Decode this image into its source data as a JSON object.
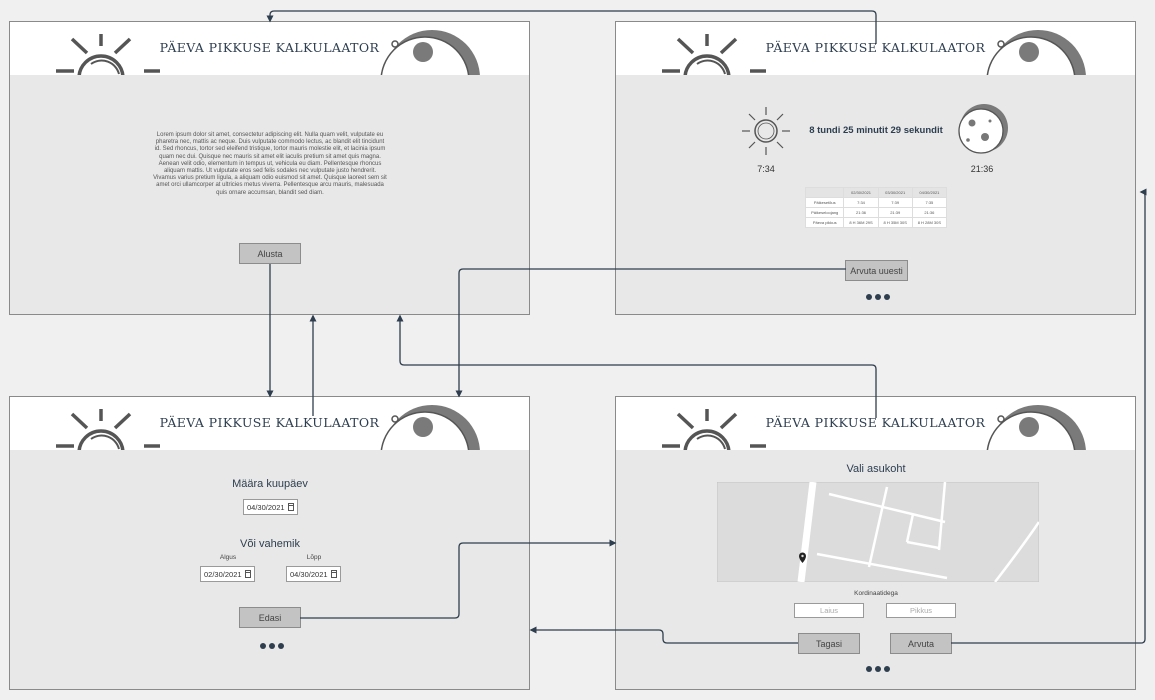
{
  "app": {
    "title": "PÄEVA PIKKUSE KALKULAATOR"
  },
  "colors": {
    "accent": "#2f3e4e",
    "panel": "#e8e8e8",
    "button": "#c3c3c3"
  },
  "screen_start": {
    "intro_text": "Lorem ipsum dolor sit amet, consectetur adipiscing elit. Nulla quam velit, vulputate eu pharetra nec, mattis ac neque. Duis vulputate commodo lectus, ac blandit elit tincidunt id. Sed rhoncus, tortor sed eleifend tristique, tortor mauris molestie elit, et lacinia ipsum quam nec dui. Quisque nec mauris sit amet elit iaculis pretium sit amet quis magna. Aenean velit odio, elementum in tempus ut, vehicula eu diam. Pellentesque rhoncus aliquam mattis. Ut vulputate eros sed felis sodales nec vulputate justo hendrerit. Vivamus varius pretium ligula, a aliquam odio euismod sit amet. Quisque laoreet sem sit amet orci ullamcorper at ultricies metus viverra. Pellentesque arcu mauris, malesuada quis ornare accumsan, blandit sed diam.",
    "start_button": "Alusta"
  },
  "screen_result": {
    "day_length": "8 tundi 25 minutit 29 sekundit",
    "sunrise": "7:34",
    "sunset": "21:36",
    "table": {
      "headers": [
        "",
        "02/30/2021",
        "03/30/2021",
        "04/30/2021"
      ],
      "rows": [
        [
          "Päikesetõus",
          "7:34",
          "7:39",
          "7:35"
        ],
        [
          "Päikeseloojang",
          "21:36",
          "21:39",
          "21:36"
        ],
        [
          "Päeva pikkus",
          "8 H 36M 29S",
          "8 H 35M 30S",
          "8 H 28M 30S"
        ]
      ]
    },
    "recalc_button": "Arvuta uuesti"
  },
  "screen_date": {
    "date_heading": "Määra kuupäev",
    "date_value": "04/30/2021",
    "range_heading": "Või vahemik",
    "start_label": "Algus",
    "start_value": "02/30/2021",
    "end_label": "Lõpp",
    "end_value": "04/30/2021",
    "next_button": "Edasi"
  },
  "screen_location": {
    "heading": "Vali asukoht",
    "coords_label": "Kordinaatidega",
    "lat_placeholder": "Laius",
    "lon_placeholder": "Pikkus",
    "back_button": "Tagasi",
    "calc_button": "Arvuta"
  }
}
